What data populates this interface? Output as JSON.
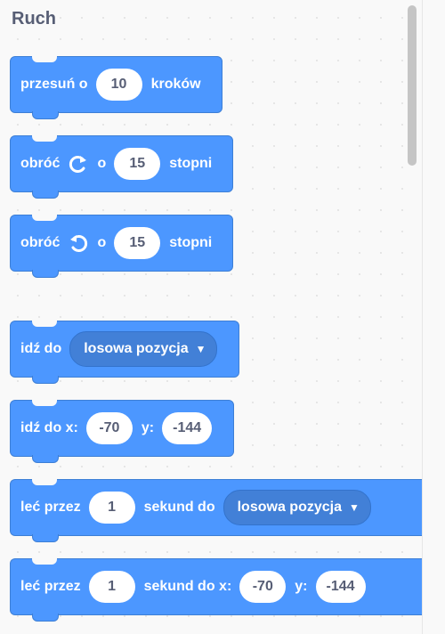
{
  "category": {
    "title": "Ruch"
  },
  "blocks": {
    "move": {
      "label_before": "przesuń o",
      "steps": "10",
      "label_after": "kroków"
    },
    "turn_right": {
      "label_before": "obróć",
      "icon": "rotate-clockwise-icon",
      "label_mid": "o",
      "degrees": "15",
      "label_after": "stopni"
    },
    "turn_left": {
      "label_before": "obróć",
      "icon": "rotate-counterclockwise-icon",
      "label_mid": "o",
      "degrees": "15",
      "label_after": "stopni"
    },
    "goto": {
      "label": "idź do",
      "target": "losowa pozycja"
    },
    "goto_xy": {
      "label": "idź do x:",
      "x": "-70",
      "label_y": "y:",
      "y": "-144"
    },
    "glide_to": {
      "label_before": "leć przez",
      "secs": "1",
      "label_mid": "sekund do",
      "target": "losowa pozycja"
    },
    "glide_xy": {
      "label_before": "leć przez",
      "secs": "1",
      "label_mid": "sekund do x:",
      "x": "-70",
      "label_y": "y:",
      "y": "-144"
    }
  },
  "colors": {
    "motion": "#4c97ff",
    "motion_dark": "#4280d7",
    "text_gray": "#575e75"
  }
}
